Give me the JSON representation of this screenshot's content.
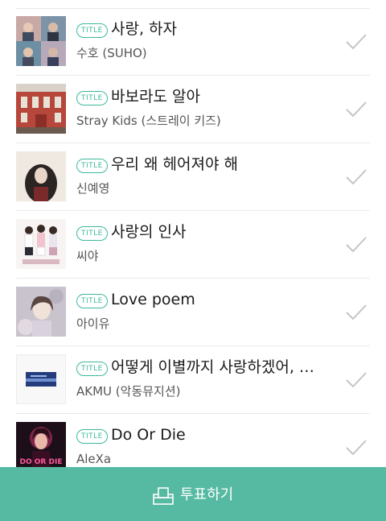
{
  "badge_label": "TITLE",
  "songs": [
    {
      "title": "사랑, 하자",
      "artist": "수호 (SUHO)",
      "cover": "group-portraits"
    },
    {
      "title": "바보라도 알아",
      "artist": "Stray Kids (스트레이 키즈)",
      "cover": "red-brick-building"
    },
    {
      "title": "우리 왜 헤어져야 해",
      "artist": "신예영",
      "cover": "dark-haired-figure"
    },
    {
      "title": "사랑의 인사",
      "artist": "씨야",
      "cover": "three-women"
    },
    {
      "title": "Love poem",
      "artist": "아이유",
      "cover": "soft-portrait"
    },
    {
      "title": "어떻게 이별까지 사랑하겠어, …",
      "artist": "AKMU (악동뮤지션)",
      "cover": "blue-water-frame"
    },
    {
      "title": "Do Or Die",
      "artist": "AleXa",
      "cover": "neon-do-or-die"
    }
  ],
  "cover_text": {
    "do_or_die": "DO OR DIE"
  },
  "footer": {
    "vote_label": "투표하기",
    "icon": "ballot-box-icon"
  },
  "colors": {
    "accent": "#3bb89b",
    "footer_bg": "#56b9a2",
    "check": "#c4c4c4"
  }
}
